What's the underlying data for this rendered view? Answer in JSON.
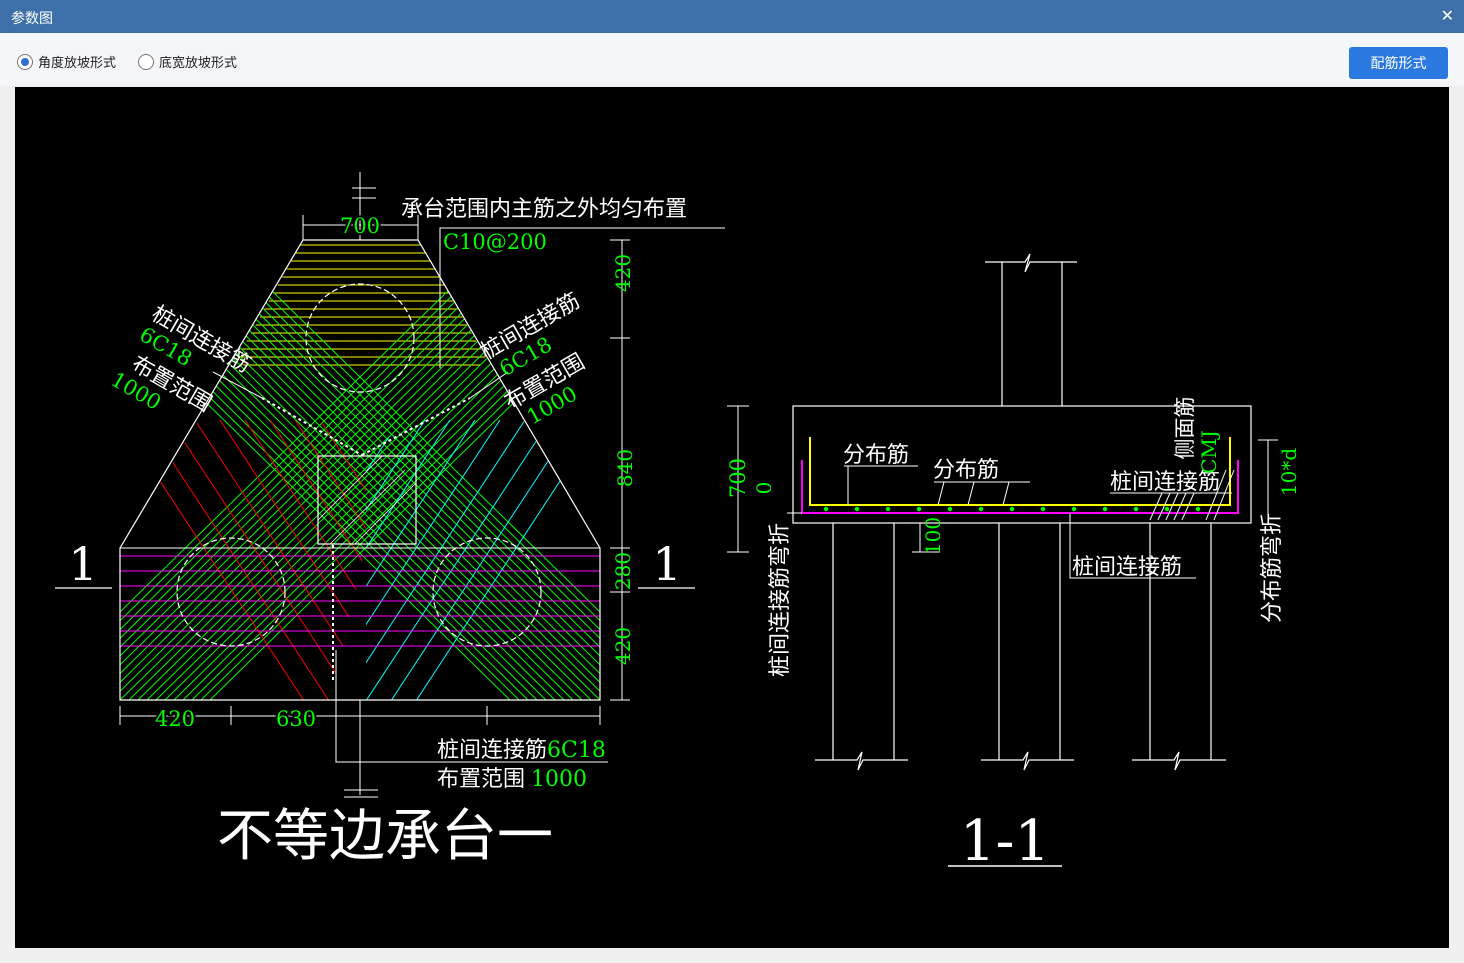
{
  "window": {
    "title": "参数图",
    "close_glyph": "✕"
  },
  "options": {
    "slope_angle_label": "角度放坡形式",
    "slope_width_label": "底宽放坡形式",
    "selected": "slope_angle",
    "rebar_button_label": "配筋形式"
  },
  "drawing": {
    "plan": {
      "title": "不等边承台一",
      "top_note": "承台范围内主筋之外均匀布置",
      "top_spacing": "C10@200",
      "dim_top": "700",
      "dims_right": [
        "420",
        "840",
        "280",
        "420"
      ],
      "dims_bottom": [
        "420",
        "630"
      ],
      "section_mark": "1",
      "left_label": {
        "name": "桩间连接筋",
        "bars": "6C18",
        "range_label": "布置范围",
        "range": "1000"
      },
      "right_label": {
        "name": "桩间连接筋",
        "bars": "6C18",
        "range_label": "布置范围",
        "range": "1000"
      },
      "bottom_label": {
        "name": "桩间连接筋",
        "bars": "6C18",
        "range_label": "布置范围",
        "range": "1000"
      }
    },
    "section": {
      "title": "1-1",
      "dist_bar_1": "分布筋",
      "dist_bar_2": "分布筋",
      "pile_bar_right": "桩间连接筋",
      "pile_bar_bottom": "桩间连接筋",
      "side_bar": "侧面筋",
      "side_bar_code": "CMJ",
      "height": "700",
      "cover": "0",
      "cover_bottom": "100",
      "left_vertical": "桩间连接筋弯折",
      "right_vertical": "分布筋弯折",
      "bend_length": "10*d"
    }
  },
  "colors": {
    "title_bar": "#3d6fa8",
    "button": "#2b79e0",
    "green": "#00ff00",
    "yellow": "#ffff00",
    "magenta": "#ff00ff",
    "red": "#ff0000",
    "cyan": "#00ffff",
    "white": "#ffffff"
  }
}
